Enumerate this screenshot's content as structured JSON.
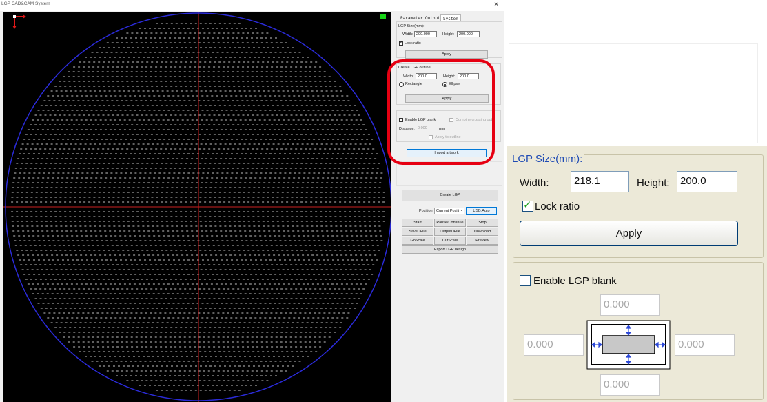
{
  "window": {
    "title": "LGP CAD&CAM System",
    "close_icon": "close-icon"
  },
  "canvas": {
    "background": "#000000",
    "outline_color": "#2b2bd9",
    "axis_color": "#cc1f1f",
    "dot_color": "#ffffff",
    "indicator_color": "#17d417",
    "origin_icon": "origin-axes-icon"
  },
  "tabs": [
    "Parameter",
    "Output",
    "System"
  ],
  "lgp_size": {
    "group_label": "LGP Size(mm):",
    "width_label": "Width:",
    "width_value": "200.000",
    "height_label": "Height:",
    "height_value": "200.000",
    "lock_ratio_label": "Lock ratio",
    "apply_label": "Apply"
  },
  "outline": {
    "group_label": "Create LGP outline",
    "width_label": "Width:",
    "width_value": "200.0",
    "height_label": "Height:",
    "height_value": "200.0",
    "rectangle_label": "Rectangle",
    "ellipse_label": "Ellipse",
    "apply_label": "Apply"
  },
  "blank": {
    "enable_label": "Enable LGP blank",
    "combine_label": "Combine crossing out",
    "distance_label": "Distance:",
    "distance_value": "0.000",
    "unit": "mm",
    "apply_outline_label": "Apply to outline"
  },
  "import_label": "Import artwork",
  "create_lgp_label": "Create LGP",
  "position_label": "Position:",
  "position_value": "Current Positi",
  "usb_label": "USB:Auto",
  "actions": [
    [
      "Start",
      "Pause/Continue",
      "Stop"
    ],
    [
      "SaveUFile",
      "OutputUFile",
      "Download"
    ],
    [
      "GoScale",
      "CutScale",
      "Preview"
    ]
  ],
  "export_label": "Export LGP design",
  "highlight_color": "#e60012",
  "zoom": {
    "group_label": "LGP Size(mm):",
    "width_label": "Width:",
    "width_value": "218.1",
    "height_label": "Height:",
    "height_value": "200.0",
    "lock_ratio_label": "Lock ratio",
    "apply_label": "Apply",
    "enable_blank_label": "Enable LGP blank",
    "margin_top": "0.000",
    "margin_left": "0.000",
    "margin_right": "0.000",
    "margin_bottom": "0.000"
  }
}
